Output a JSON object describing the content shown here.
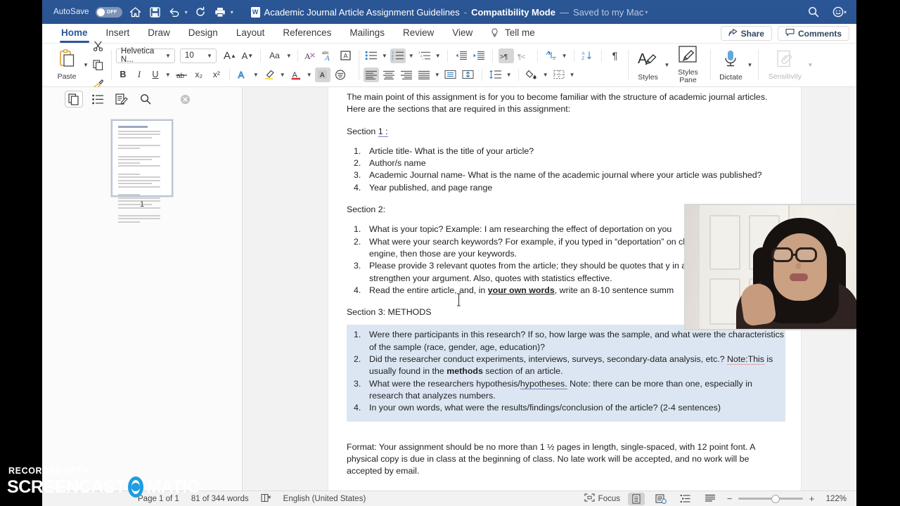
{
  "titlebar": {
    "autosave_label": "AutoSave",
    "autosave_state": "OFF",
    "doc_title": "Academic Journal Article Assignment Guidelines",
    "separator": "-",
    "mode": "Compatibility Mode",
    "dash": "—",
    "saved_status": "Saved to my Mac",
    "icons": [
      "home-icon",
      "save-icon",
      "undo-icon",
      "redo-icon",
      "print-icon",
      "customize-toolbar-icon"
    ],
    "right_icons": [
      "search-icon",
      "smiley-feedback-icon"
    ]
  },
  "tabs": [
    {
      "label": "Home",
      "active": true
    },
    {
      "label": "Insert",
      "active": false
    },
    {
      "label": "Draw",
      "active": false
    },
    {
      "label": "Design",
      "active": false
    },
    {
      "label": "Layout",
      "active": false
    },
    {
      "label": "References",
      "active": false
    },
    {
      "label": "Mailings",
      "active": false
    },
    {
      "label": "Review",
      "active": false
    },
    {
      "label": "View",
      "active": false
    },
    {
      "label": "Tell me",
      "active": false
    }
  ],
  "tabbar_right": {
    "share_label": "Share",
    "comments_label": "Comments"
  },
  "ribbon": {
    "paste_label": "Paste",
    "font_name": "Helvetica N...",
    "font_size": "10",
    "styles_label": "Styles",
    "styles_pane_label": "Styles\nPane",
    "styles_pane_line1": "Styles",
    "styles_pane_line2": "Pane",
    "dictate_label": "Dictate",
    "sensitivity_label": "Sensitivity",
    "bold": "B",
    "italic": "I",
    "underline": "U",
    "strikethrough": "ab",
    "subscript": "x₂",
    "superscript": "x²",
    "change_case": "Aa",
    "grow_font": "A",
    "shrink_font": "A",
    "pilcrow": "¶"
  },
  "navpane": {
    "tools": [
      "pages-thumbnail-icon",
      "document-outline-icon",
      "edit-document-icon",
      "search-icon",
      "close-icon"
    ],
    "thumbnail_page_number": "1"
  },
  "document": {
    "intro": "The main point of this assignment is for you to become familiar with the structure of academic journal articles. Here are the sections that are required in this assignment:",
    "section1_heading_prefix": "Section ",
    "section1_heading_num": "1 :",
    "section1_items": [
      "Article title- What is the title of your article?",
      "Author/s name",
      "Academic Journal name- What is the name of the academic journal where your article was published?",
      "Year published, and page range"
    ],
    "section2_heading": "Section 2:",
    "section2_items": [
      "What is your topic? Example: I am researching the effect of deportation on you",
      "What were your search keywords?  For example, if you typed in “deportation” on children” in the search engine, then those are your keywords.",
      "Please provide 3 relevant quotes from the article; they should be quotes that y in a research paper to strengthen your argument.  Also, quotes with statistics effective.",
      "Read the entire article, and, in your own words, write an 8-10 sentence summ"
    ],
    "section2_item2_line1": "What were your search keywords?  For example, if you typed in “deportation”",
    "section2_item2_line2": "on children” in the search engine, then those are your keywords.",
    "section2_item3_line1": "Please provide 3 relevant quotes from the article; they should be quotes that y",
    "section2_item3_line2": "in a research paper to strengthen your argument.  Also, quotes with statistics",
    "section2_item3_line3": "effective.",
    "section2_item4_a": "Read the entire article, and, in ",
    "section2_item4_bold": "your own words",
    "section2_item4_b": ", write an 8-10 sentence summ",
    "section3_heading": "Section 3: METHODS",
    "section3_items": [
      "Were there participants in this research? If so, how large was the sample, and what were the characteristics of the sample (race, gender, age, education)?",
      "Did the researcher conduct experiments, interviews, surveys, secondary-data analysis, etc.? Note:This is usually found in the methods section of an article.",
      "What were the researchers hypothesis/hypotheses. Note: there can be more than one, especially in research that analyzes numbers.",
      "In your own words, what were the results/findings/conclusion of the article? (2-4 sentences)"
    ],
    "s3_i1_l1": "Were there participants in this research? If so, how large was the sample, and what were the",
    "s3_i1_l2": "characteristics of the sample (race, gender, age, education)?",
    "s3_i2_l1": "Did the researcher conduct experiments, interviews, surveys, secondary-data analysis, etc.?",
    "s3_i2_note": "Note:This",
    "s3_i2_l2a": " is usually found in the ",
    "s3_i2_bold": "methods",
    "s3_i2_l2b": " section of an article.",
    "s3_i3_l1a": "What were the researchers hypothesis/",
    "s3_i3_link": "hypotheses.",
    "s3_i3_l1b": " Note: there can be more than one,",
    "s3_i3_l2": "especially in research that analyzes numbers.",
    "s3_i4": "In your own words, what were the results/findings/conclusion of the article? (2-4 sentences)",
    "format_l1": " Format: Your assignment should be no more than 1 ½ pages in length, single-spaced, with 12",
    "format_l2": "point font. A physical copy is due in class at the beginning of class. No late work will be",
    "format_l3": "accepted, and no work will be accepted by email."
  },
  "statusbar": {
    "page_status": "Page 1 of 1",
    "word_count": "81 of 344 words",
    "proofing_icon": "spelling-check-icon",
    "language": "English (United States)",
    "focus_label": "Focus",
    "views": [
      "print-layout-icon",
      "web-layout-icon",
      "outline-icon",
      "draft-icon"
    ],
    "zoom_out": "−",
    "zoom_in": "+",
    "zoom_value": "122%"
  },
  "watermark": {
    "line1": "RECORDED WITH",
    "word1": "SCREENCAST",
    "word2": "MATIC"
  },
  "colors": {
    "titlebar": "#2b5797",
    "accent": "#2b579a",
    "selection": "#dce6f2",
    "watermark_ring": "#1e9ee0"
  }
}
